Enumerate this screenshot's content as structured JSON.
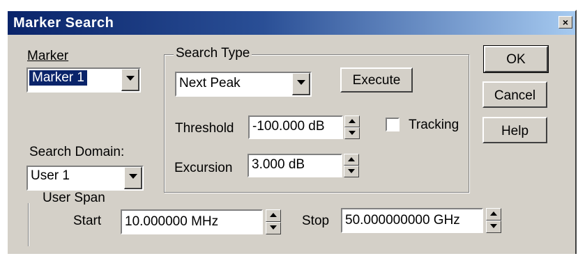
{
  "window": {
    "title": "Marker Search",
    "close_glyph": "×"
  },
  "marker": {
    "label": "Marker",
    "selected": "Marker 1"
  },
  "search_domain": {
    "label": "Search Domain:",
    "selected": "User 1"
  },
  "search_type": {
    "label": "Search Type",
    "selected": "Next Peak",
    "execute_label": "Execute",
    "threshold_label": "Threshold",
    "threshold_value": "-100.000 dB",
    "tracking_label": "Tracking",
    "tracking_checked": false,
    "excursion_label": "Excursion",
    "excursion_value": "3.000 dB"
  },
  "user_span": {
    "label": "User Span",
    "start_label": "Start",
    "start_value": "10.000000 MHz",
    "stop_label": "Stop",
    "stop_value": "50.000000000 GHz"
  },
  "buttons": {
    "ok": "OK",
    "cancel": "Cancel",
    "help": "Help"
  }
}
